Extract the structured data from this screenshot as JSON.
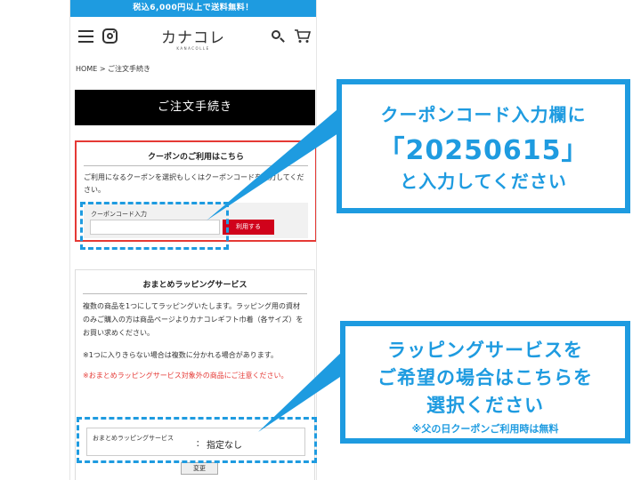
{
  "banner": {
    "text": "税込6,000円以上で送料無料！"
  },
  "header": {
    "logo": "カナコレ",
    "logo_sub": "KANACOLLE"
  },
  "breadcrumb": "HOME > ご注文手続き",
  "page_title": "ご注文手続き",
  "coupon": {
    "heading": "クーポンのご利用はこちら",
    "description": "ご利用になるクーポンを選択もしくはクーポンコードを入力してください。",
    "field_label": "クーポンコード入力",
    "input_value": "",
    "apply_label": "利用する"
  },
  "wrapping": {
    "heading": "おまとめラッピングサービス",
    "description": "複数の商品を1つにしてラッピングいたします。ラッピング用の資材のみご購入の方は商品ページよりカナコレギフト巾着（各サイズ）をお買い求めください。",
    "note": "※1つに入りきらない場合は複数に分かれる場合があります。",
    "warning": "※おまとめラッピングサービス対象外の商品にご注意ください。",
    "select_label": "おまとめラッピングサービス",
    "select_colon": "：",
    "select_value": "指定なし",
    "change_label": "変更"
  },
  "callouts": {
    "coupon": {
      "line1": "クーポンコード入力欄に",
      "line2": "「20250615」",
      "line3": "と入力してください"
    },
    "wrapping": {
      "line1": "ラッピングサービスを",
      "line2": "ご希望の場合はこちらを",
      "line3": "選択ください",
      "note": "※父の日クーポンご利用時は無料"
    }
  },
  "colors": {
    "accent": "#1e9be0",
    "coupon_border": "#e53935",
    "apply_button": "#d0021b",
    "title_bar": "#000000"
  }
}
